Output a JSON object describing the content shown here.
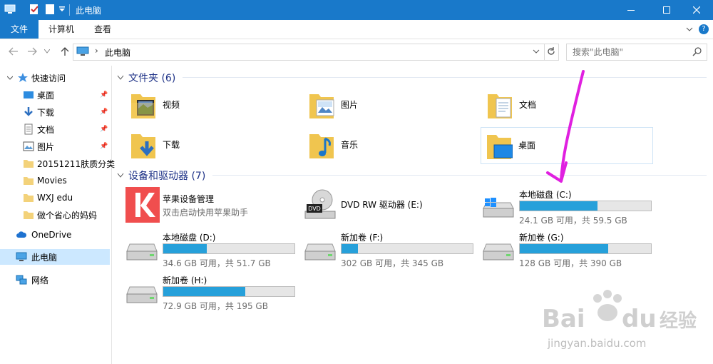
{
  "window": {
    "title": "此电脑"
  },
  "ribbon": {
    "tabs": [
      "文件",
      "计算机",
      "查看"
    ]
  },
  "address": {
    "crumb": "此电脑",
    "separator": "›"
  },
  "search": {
    "placeholder": "搜索\"此电脑\""
  },
  "nav": {
    "quick_access": "快速访问",
    "pinned": [
      {
        "label": "桌面",
        "icon": "desktop-icon"
      },
      {
        "label": "下载",
        "icon": "download-icon"
      },
      {
        "label": "文档",
        "icon": "document-icon"
      },
      {
        "label": "图片",
        "icon": "pictures-icon"
      }
    ],
    "folders": [
      "20151211肤质分类",
      "Movies",
      "WXJ edu",
      "做个省心的妈妈"
    ],
    "onedrive": "OneDrive",
    "this_pc": "此电脑",
    "network": "网络"
  },
  "folders_group": {
    "title": "文件夹 (6)"
  },
  "folders": [
    {
      "name": "视频",
      "icon": "videos-folder-icon"
    },
    {
      "name": "图片",
      "icon": "pictures-folder-icon"
    },
    {
      "name": "文档",
      "icon": "documents-folder-icon"
    },
    {
      "name": "下载",
      "icon": "downloads-folder-icon"
    },
    {
      "name": "音乐",
      "icon": "music-folder-icon"
    },
    {
      "name": "桌面",
      "icon": "desktop-folder-icon"
    }
  ],
  "devices_group": {
    "title": "设备和驱动器 (7)"
  },
  "apple_app": {
    "name": "苹果设备管理",
    "sub": "双击启动快用苹果助手"
  },
  "dvd": {
    "name": "DVD RW 驱动器 (E:)"
  },
  "drives": [
    {
      "name": "本地磁盘 (C:)",
      "info": "24.1 GB 可用，共 59.5 GB",
      "used_fraction": 0.595
    },
    {
      "name": "本地磁盘 (D:)",
      "info": "34.6 GB 可用，共 51.7 GB",
      "used_fraction": 0.331
    },
    {
      "name": "新加卷 (F:)",
      "info": "302 GB 可用，共 345 GB",
      "used_fraction": 0.125
    },
    {
      "name": "新加卷 (G:)",
      "info": "128 GB 可用，共 390 GB",
      "used_fraction": 0.672
    },
    {
      "name": "新加卷 (H:)",
      "info": "72.9 GB 可用，共 195 GB",
      "used_fraction": 0.626
    }
  ],
  "colors": {
    "titlebar": "#1979ca",
    "accent": "#26a0da",
    "annotation": "#e020e0",
    "group_title": "#1e3287"
  },
  "watermark": {
    "brand": "Bai du 经验",
    "url": "jingyan.baidu.com"
  }
}
